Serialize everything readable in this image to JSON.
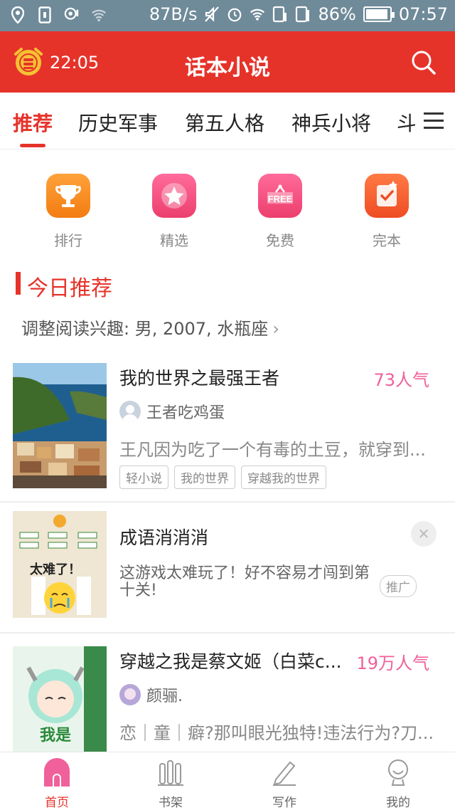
{
  "status_bar": {
    "speed": "87B/s",
    "battery": "86%",
    "time": "07:57"
  },
  "app_bar": {
    "alarm_time": "22:05",
    "title": "话本小说"
  },
  "tabs": [
    {
      "label": "推荐"
    },
    {
      "label": "历史军事"
    },
    {
      "label": "第五人格"
    },
    {
      "label": "神兵小将"
    },
    {
      "label": "斗破"
    }
  ],
  "quick_links": [
    {
      "label": "排行",
      "color": "#f7891f",
      "icon": "trophy-icon"
    },
    {
      "label": "精选",
      "color": "#f0507e",
      "icon": "star-icon"
    },
    {
      "label": "免费",
      "color": "#f0507e",
      "icon": "free-tag-icon",
      "icon_text": "FREE"
    },
    {
      "label": "完本",
      "color": "#f2622e",
      "icon": "check-note-icon"
    }
  ],
  "section": {
    "title": "今日推荐",
    "interest": "调整阅读兴趣: 男, 2007, 水瓶座",
    "interest_chevron": "›"
  },
  "books": [
    {
      "title": "我的世界之最强王者",
      "popularity": "73人气",
      "author": "王者吃鸡蛋",
      "desc": "王凡因为吃了一个有毒的土豆，就穿到...",
      "tags": [
        "轻小说",
        "我的世界",
        "穿越我的世界"
      ]
    },
    {
      "title": "穿越之我是蔡文姬（白菜c...",
      "popularity": "19万人气",
      "author": "颜骊.",
      "desc": "恋｜童｜癖?那叫眼光独特!违法行为?刀..."
    }
  ],
  "ad": {
    "title": "成语消消消",
    "desc": "这游戏太难玩了！好不容易才闯到第十关!",
    "badge": "推广",
    "close": "✕",
    "cover_text": "太难了！"
  },
  "bottom_nav": [
    {
      "label": "首页",
      "active": true
    },
    {
      "label": "书架",
      "active": false
    },
    {
      "label": "写作",
      "active": false
    },
    {
      "label": "我的",
      "active": false
    }
  ],
  "colors": {
    "brand": "#e6332a",
    "popularity": "#f0609a",
    "status_bar": "#6f8a99"
  }
}
